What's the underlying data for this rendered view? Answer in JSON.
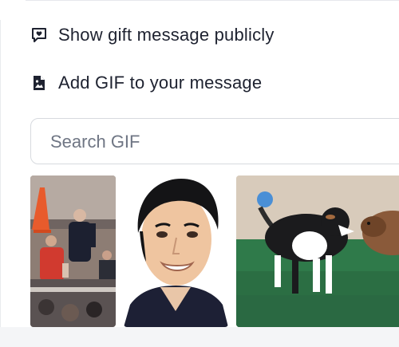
{
  "options": {
    "show_public_label": "Show gift message publicly",
    "add_gif_label": "Add GIF to your message"
  },
  "search": {
    "placeholder": "Search GIF",
    "value": ""
  },
  "gifs": [
    {
      "subject": "crowd-celebration"
    },
    {
      "subject": "portrait-smiling-man"
    },
    {
      "subject": "dog-and-capybara"
    }
  ],
  "colors": {
    "text": "#1e2230",
    "placeholder": "#6f7684",
    "border": "#d7dadf"
  },
  "icons": {
    "show_public": "message-heart-icon",
    "add_gif": "image-file-icon"
  }
}
